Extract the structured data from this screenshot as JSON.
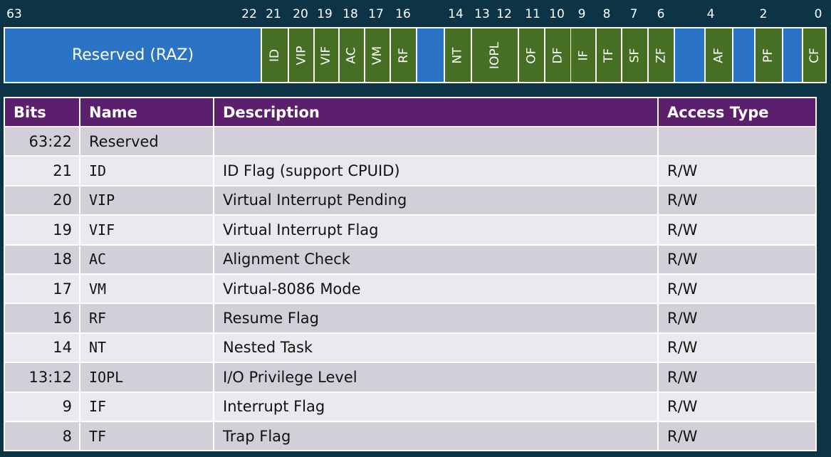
{
  "bit_numbers": [
    "63",
    "22",
    "21",
    "20",
    "19",
    "18",
    "17",
    "16",
    "14",
    "13",
    "12",
    "11",
    "10",
    "9",
    "8",
    "7",
    "6",
    "4",
    "2",
    "0"
  ],
  "register": {
    "fields": [
      {
        "label": "Reserved (RAZ)",
        "kind": "reserved"
      },
      {
        "label": "ID",
        "kind": "flag"
      },
      {
        "label": "VIP",
        "kind": "flag"
      },
      {
        "label": "VIF",
        "kind": "flag"
      },
      {
        "label": "AC",
        "kind": "flag"
      },
      {
        "label": "VM",
        "kind": "flag"
      },
      {
        "label": "RF",
        "kind": "flag"
      },
      {
        "label": "",
        "kind": "reserved"
      },
      {
        "label": "NT",
        "kind": "flag"
      },
      {
        "label": "IOPL",
        "kind": "flag"
      },
      {
        "label": "OF",
        "kind": "flag"
      },
      {
        "label": "DF",
        "kind": "flag"
      },
      {
        "label": "IF",
        "kind": "flag"
      },
      {
        "label": "TF",
        "kind": "flag"
      },
      {
        "label": "SF",
        "kind": "flag"
      },
      {
        "label": "ZF",
        "kind": "flag"
      },
      {
        "label": "",
        "kind": "reserved"
      },
      {
        "label": "AF",
        "kind": "flag"
      },
      {
        "label": "",
        "kind": "reserved"
      },
      {
        "label": "PF",
        "kind": "flag"
      },
      {
        "label": "",
        "kind": "reserved"
      },
      {
        "label": "CF",
        "kind": "flag"
      }
    ]
  },
  "table": {
    "headers": {
      "bits": "Bits",
      "name": "Name",
      "description": "Description",
      "access": "Access Type"
    },
    "rows": [
      {
        "bits": "63:22",
        "name": "Reserved",
        "description": "",
        "access": ""
      },
      {
        "bits": "21",
        "name": "ID",
        "description": "ID Flag (support CPUID)",
        "access": "R/W"
      },
      {
        "bits": "20",
        "name": "VIP",
        "description": "Virtual Interrupt Pending",
        "access": "R/W"
      },
      {
        "bits": "19",
        "name": "VIF",
        "description": "Virtual Interrupt Flag",
        "access": "R/W"
      },
      {
        "bits": "18",
        "name": "AC",
        "description": "Alignment Check",
        "access": "R/W"
      },
      {
        "bits": "17",
        "name": "VM",
        "description": "Virtual-8086 Mode",
        "access": "R/W"
      },
      {
        "bits": "16",
        "name": "RF",
        "description": "Resume Flag",
        "access": "R/W"
      },
      {
        "bits": "14",
        "name": "NT",
        "description": "Nested Task",
        "access": "R/W"
      },
      {
        "bits": "13:12",
        "name": "IOPL",
        "description": "I/O Privilege Level",
        "access": "R/W"
      },
      {
        "bits": "9",
        "name": "IF",
        "description": "Interrupt Flag",
        "access": "R/W"
      },
      {
        "bits": "8",
        "name": "TF",
        "description": "Trap Flag",
        "access": "R/W"
      }
    ]
  }
}
